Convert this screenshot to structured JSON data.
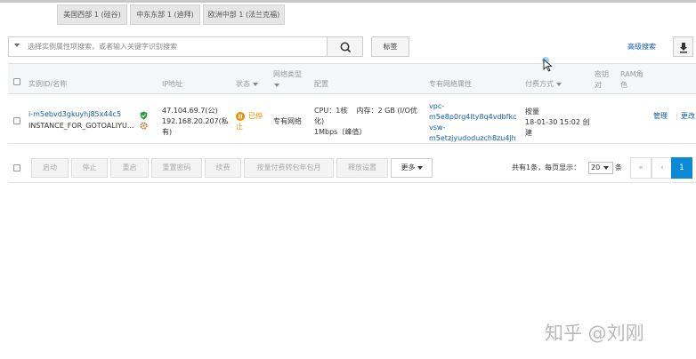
{
  "regions": [
    "美国西部 1 (硅谷)",
    "中东东部 1 (迪拜)",
    "欧洲中部 1 (法兰克福)"
  ],
  "search": {
    "placeholder": "选择实例属性项搜索，或者输入关键字识别搜索",
    "tag_label": "标签",
    "advanced_label": "高级搜索"
  },
  "table": {
    "headers": {
      "id_name": "实例ID/名称",
      "ip": "IP地址",
      "status": "状态",
      "network_line1": "网络类型",
      "config": "配置",
      "vpc": "专有网络属性",
      "billing": "付费方式",
      "key_line1": "密钥",
      "key_line2": "对",
      "ram_line1": "RAM角",
      "ram_line2": "色"
    },
    "row": {
      "instance_id": "i-m5ebvd3gkuyhj85x44c5",
      "instance_name": "INSTANCE_FOR_GOTOALIYU...",
      "ip_public": "47.104.69.7(公)",
      "ip_private_1": "192.168.20.207(私",
      "ip_private_2": "有)",
      "status_1": "已停",
      "status_2": "止",
      "network": "专有网络",
      "config_1": "CPU：1核    内存：2 GB (I/O优",
      "config_2": "化)",
      "config_3": "1Mbps（峰值）",
      "vpc_1": "vpc-",
      "vpc_2": "m5e8p0rg4lty8q4vdbfkc",
      "vsw_1": "vsw-",
      "vsw_2": "m5etzjyudoduzch8zu4jh",
      "billing_1": "按量",
      "billing_2": "18-01-30 15:02 创",
      "billing_3": "建",
      "action_manage": "管理",
      "action_more": "更改"
    }
  },
  "footer": {
    "buttons": [
      "启动",
      "停止",
      "重启",
      "重置密码",
      "续费",
      "按量付费转包年包月",
      "释放设置"
    ],
    "more_label": "更多",
    "total_text": "共有1条，每页显示：",
    "page_size": "20",
    "unit_text": "条",
    "first_symbol": "«",
    "prev_symbol": "‹",
    "current_page": "1"
  },
  "watermark": "知乎 @刘刚",
  "colors": {
    "link": "#0f5fa8",
    "accent": "#0a8ad6",
    "status_stopped": "#f08c00"
  }
}
